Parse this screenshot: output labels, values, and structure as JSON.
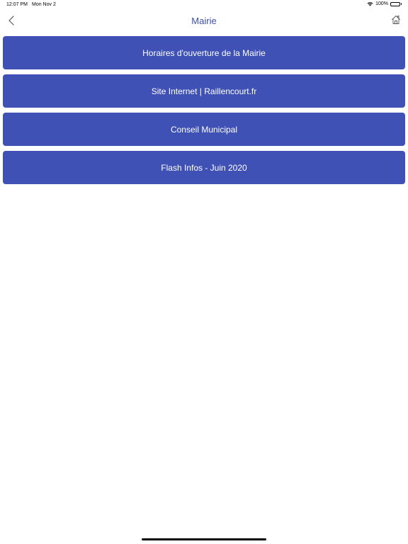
{
  "status_bar": {
    "time": "12:07 PM",
    "date": "Mon Nov 2",
    "battery_text": "100%",
    "battery_level": 1.0
  },
  "nav": {
    "title": "Mairie"
  },
  "menu": {
    "items": [
      {
        "label": "Horaires d'ouverture de la Mairie"
      },
      {
        "label": "Site Internet | Raillencourt.fr"
      },
      {
        "label": "Conseil Municipal"
      },
      {
        "label": "Flash Infos - Juin 2020"
      }
    ]
  },
  "colors": {
    "accent": "#3f51b5",
    "title": "#3d4fb0",
    "background": "#ffffff",
    "button_text": "#ffffff"
  }
}
